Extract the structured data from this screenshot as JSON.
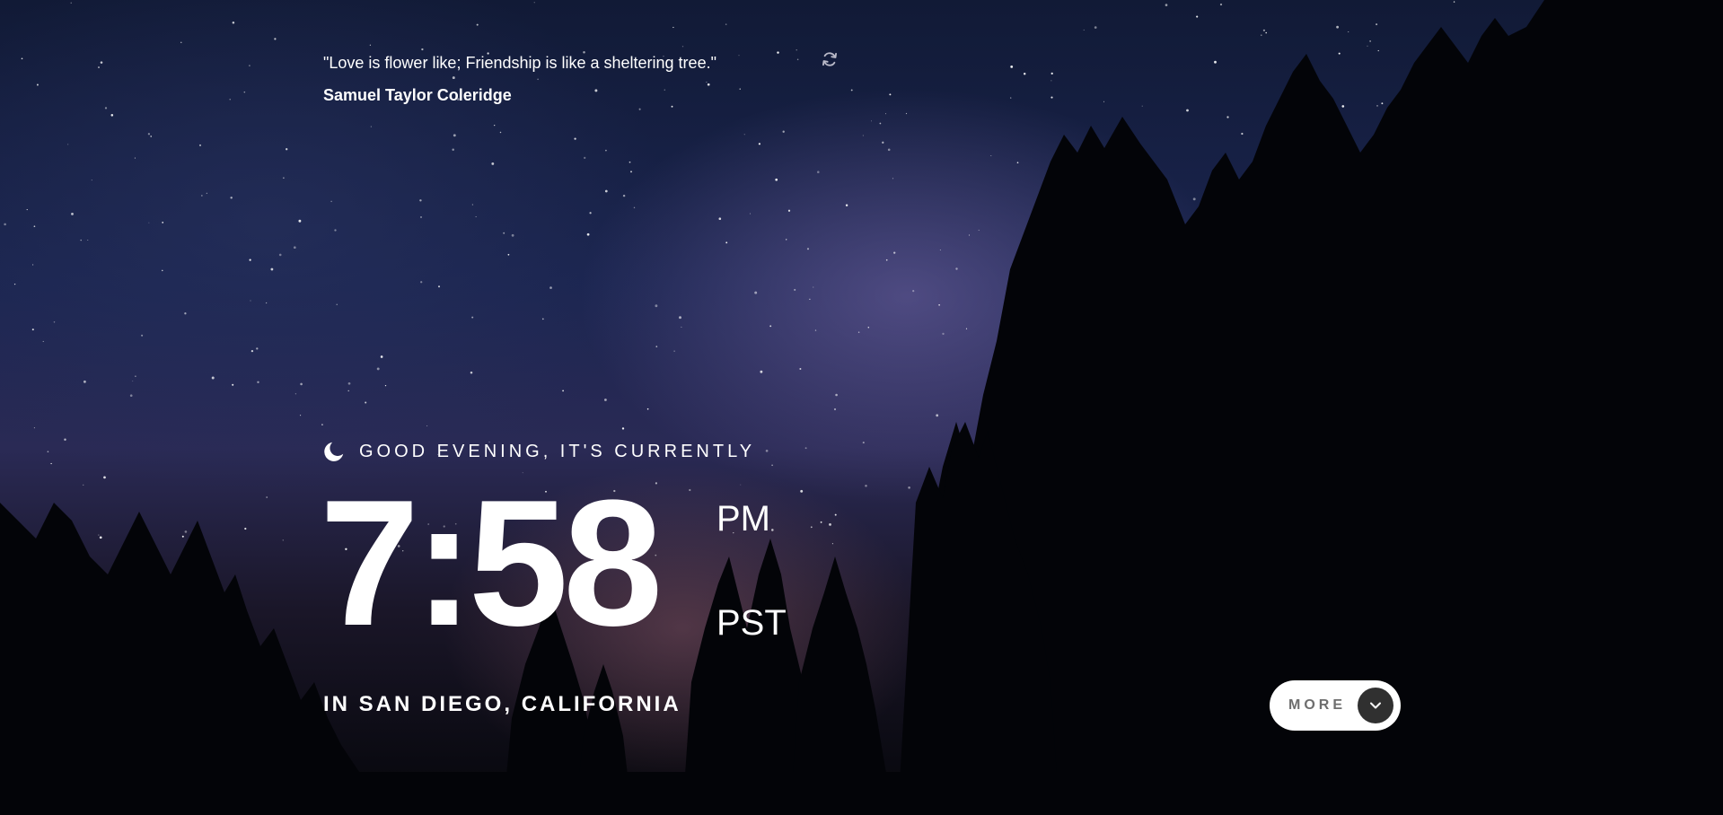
{
  "quote": {
    "text": "\"Love is flower like; Friendship is like a sheltering tree.\"",
    "author": "Samuel Taylor Coleridge",
    "refresh_icon": "refresh-icon"
  },
  "greeting": {
    "icon": "moon-icon",
    "text": "GOOD EVENING, IT'S CURRENTLY"
  },
  "clock": {
    "time": "7:58",
    "meridiem": "PM",
    "timezone": "PST"
  },
  "location": {
    "text": "IN SAN DIEGO, CALIFORNIA"
  },
  "more_button": {
    "label": "MORE",
    "icon": "chevron-down-icon"
  },
  "colors": {
    "text": "#ffffff",
    "button_bg": "#ffffff",
    "button_label": "#6e6e6e",
    "chevron_bg": "#303030"
  }
}
